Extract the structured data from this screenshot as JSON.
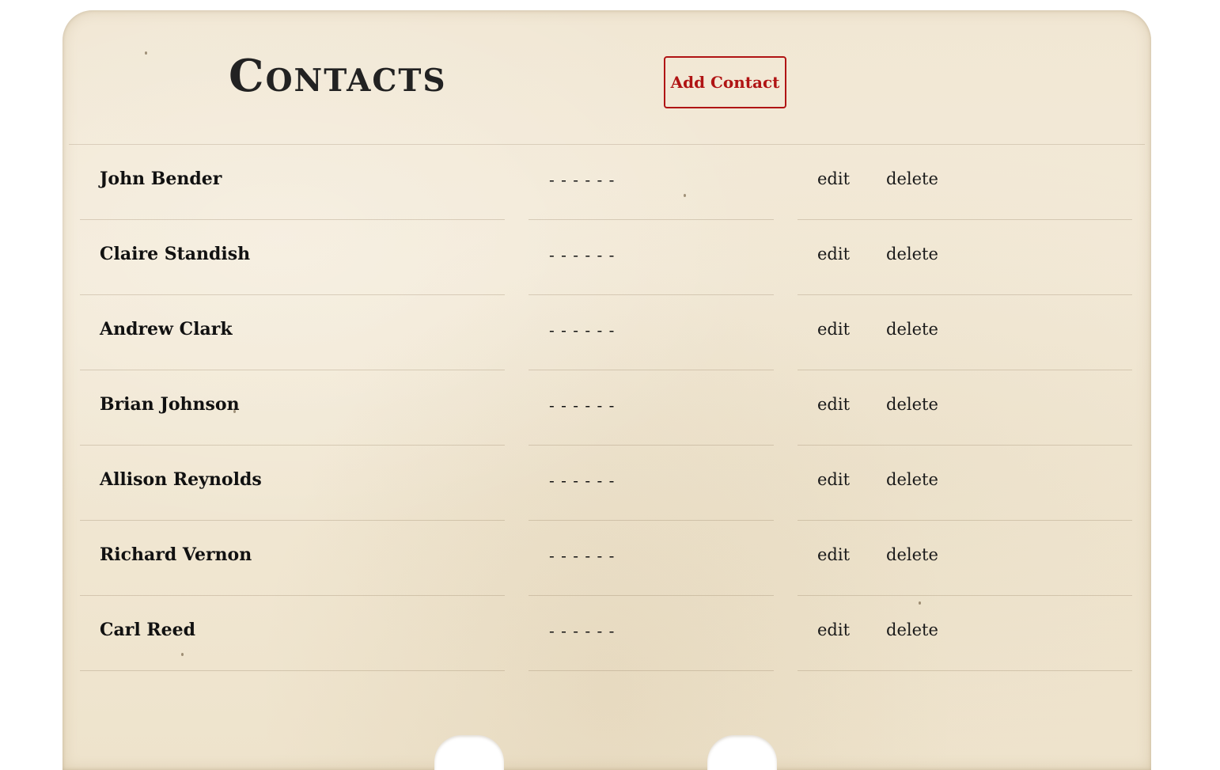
{
  "page": {
    "title": "Contacts"
  },
  "toolbar": {
    "add_label": "Add Contact"
  },
  "contacts": [
    {
      "name": "John Bender",
      "phone": "- - - - - -",
      "edit_label": "edit",
      "delete_label": "delete"
    },
    {
      "name": "Claire Standish",
      "phone": "- - - - - -",
      "edit_label": "edit",
      "delete_label": "delete"
    },
    {
      "name": "Andrew Clark",
      "phone": "- - - - - -",
      "edit_label": "edit",
      "delete_label": "delete"
    },
    {
      "name": "Brian Johnson",
      "phone": "- - - - - -",
      "edit_label": "edit",
      "delete_label": "delete"
    },
    {
      "name": "Allison Reynolds",
      "phone": "- - - - - -",
      "edit_label": "edit",
      "delete_label": "delete"
    },
    {
      "name": "Richard Vernon",
      "phone": "- - - - - -",
      "edit_label": "edit",
      "delete_label": "delete"
    },
    {
      "name": "Carl Reed",
      "phone": "- - - - - -",
      "edit_label": "edit",
      "delete_label": "delete"
    }
  ],
  "colors": {
    "accent": "#b01414",
    "paper": "#f1e7d4",
    "text": "#111111"
  }
}
